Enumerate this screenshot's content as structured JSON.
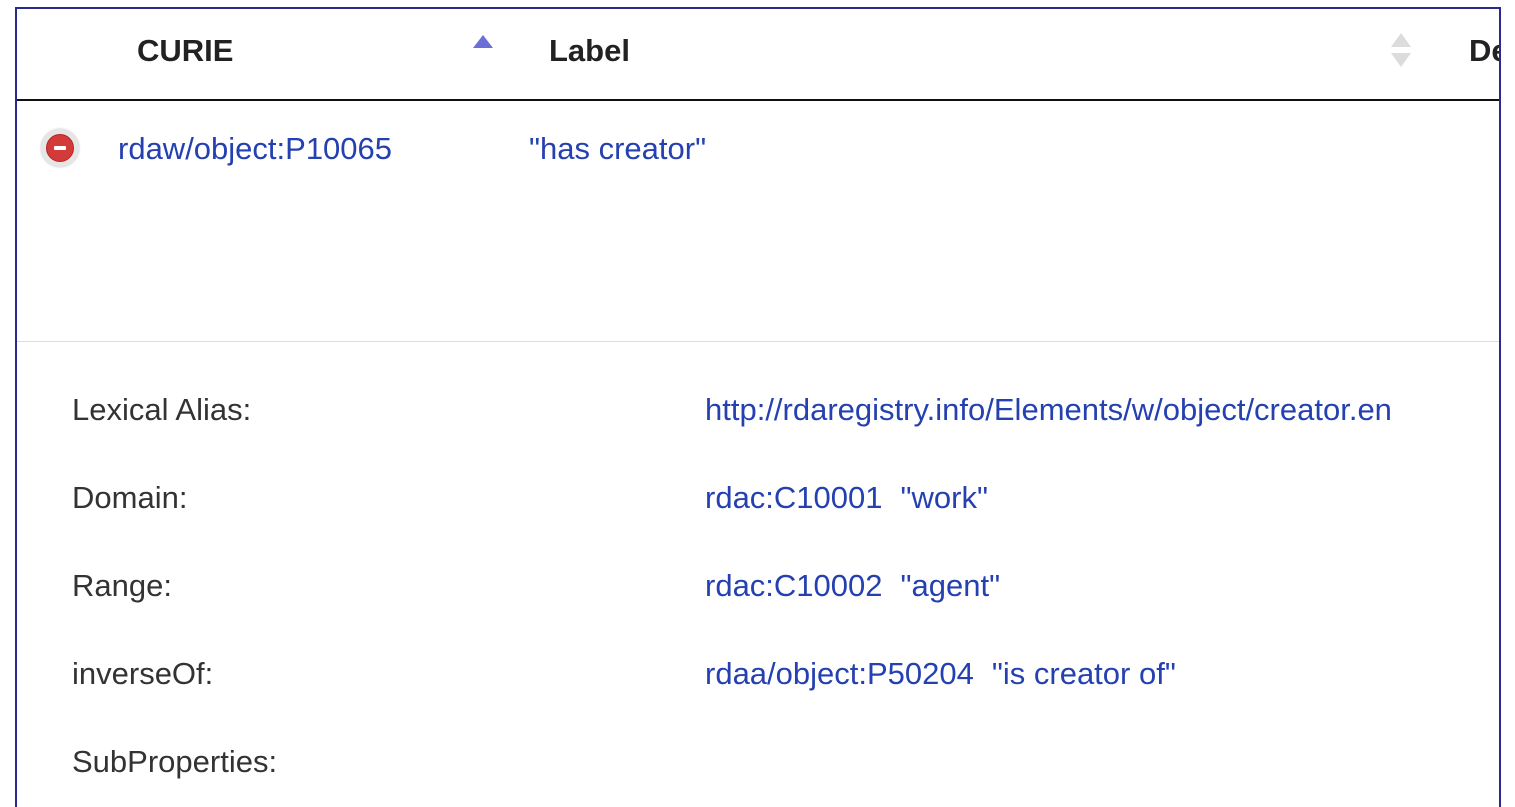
{
  "table": {
    "columns": {
      "curie": "CURIE",
      "label": "Label",
      "description": "De"
    },
    "sort": {
      "curie": "ascending",
      "label": "unsorted"
    },
    "rows": [
      {
        "curie": "rdaw/object:P10065",
        "label": "\"has creator\""
      }
    ]
  },
  "details": {
    "lexical_alias": {
      "label": "Lexical Alias:",
      "value": "http://rdaregistry.info/Elements/w/object/creator.en"
    },
    "domain": {
      "label": "Domain:",
      "curie": "rdac:C10001",
      "value_label": "\"work\""
    },
    "range": {
      "label": "Range:",
      "curie": "rdac:C10002",
      "value_label": "\"agent\""
    },
    "inverse_of": {
      "label": "inverseOf:",
      "curie": "rdaa/object:P50204",
      "value_label": "\"is creator of\""
    },
    "sub_properties": {
      "label": "SubProperties:"
    }
  },
  "colors": {
    "link": "#2540b0",
    "remove": "#d33a3a",
    "sort_active": "#6b6fd6",
    "frame_border": "#2a2a8c"
  },
  "icons": {
    "remove": "minus-circle-icon",
    "sort_active": "sort-asc-icon",
    "sort_inactive": "sort-both-icon"
  }
}
